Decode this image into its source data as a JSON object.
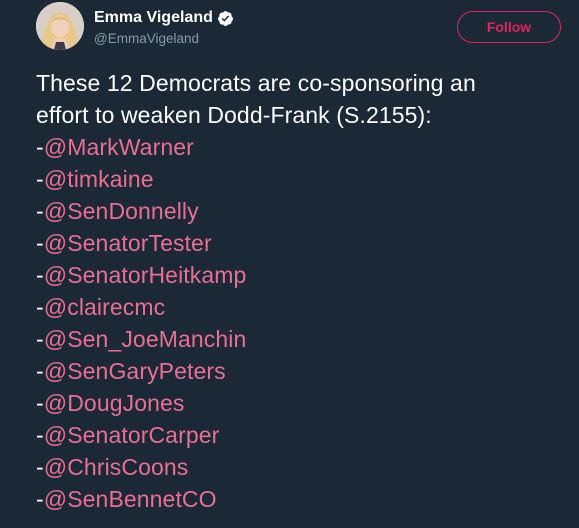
{
  "user": {
    "display_name": "Emma Vigeland",
    "handle": "@EmmaVigeland",
    "verified": true
  },
  "follow_button": {
    "label": "Follow"
  },
  "tweet": {
    "text_lines": [
      "These 12 Democrats are co-sponsoring an",
      "effort to weaken Dodd-Frank (S.2155):"
    ],
    "mention_prefix": "-",
    "mentions": [
      "@MarkWarner",
      "@timkaine",
      "@SenDonnelly",
      "@SenatorTester",
      "@SenatorHeitkamp",
      "@clairecmc",
      "@Sen_JoeManchin",
      "@SenGaryPeters",
      "@DougJones",
      "@SenatorCarper",
      "@ChrisCoons",
      "@SenBennetCO"
    ]
  },
  "colors": {
    "background": "#1b2836",
    "accent": "#e0245e",
    "mention": "#e96f92",
    "secondary_text": "#8899a6",
    "verified_badge": "#ffffff"
  },
  "icons": {
    "verified": "verified-badge-icon",
    "avatar": "profile-photo"
  }
}
